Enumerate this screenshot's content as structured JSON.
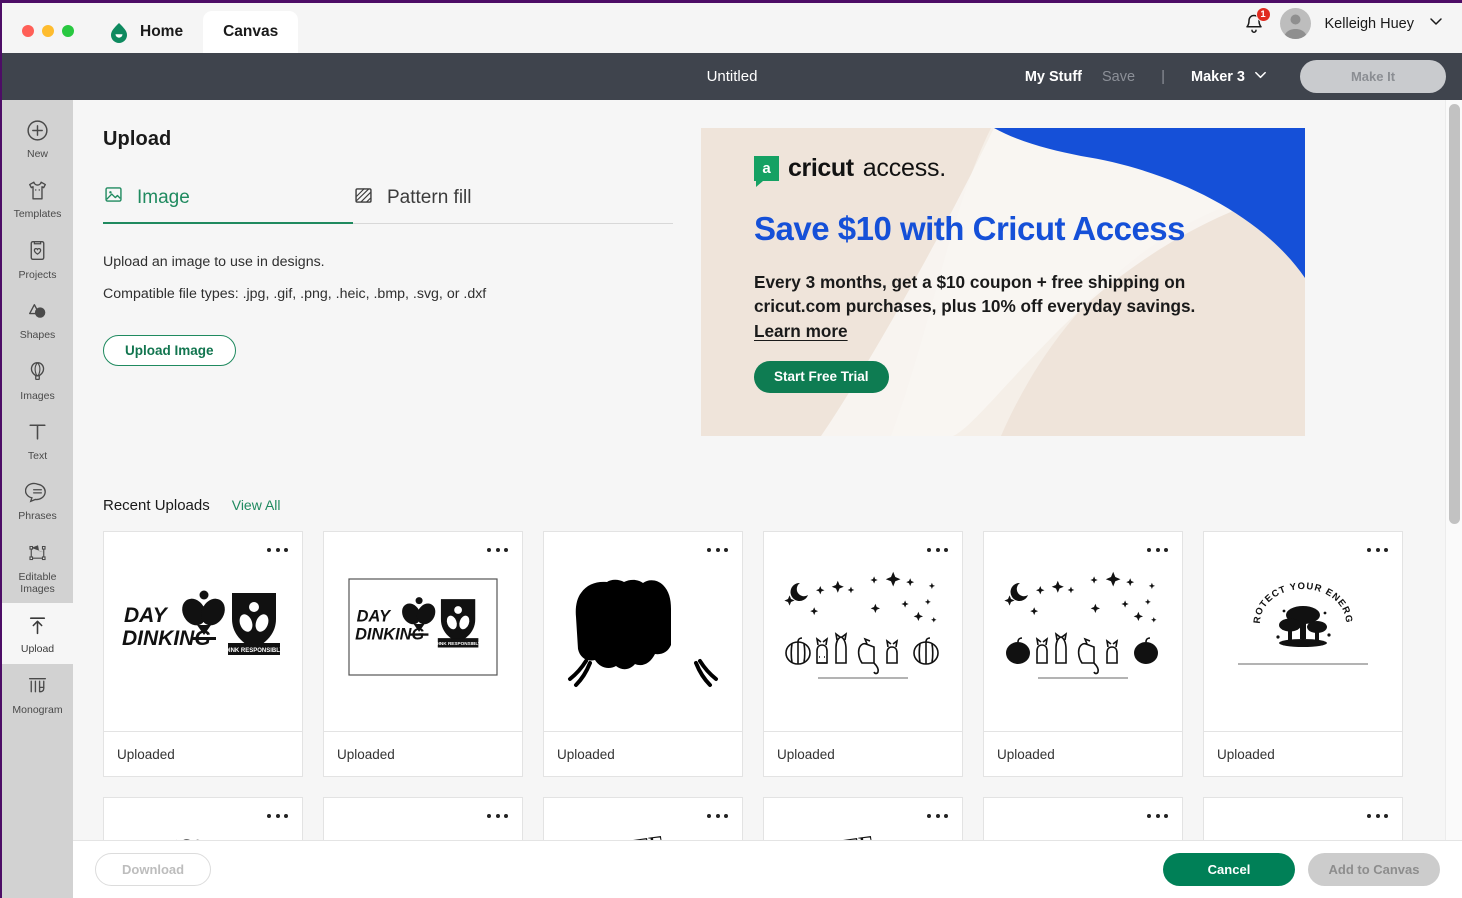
{
  "window": {
    "traffic_lights": [
      "close",
      "minimize",
      "maximize"
    ],
    "tabs": [
      {
        "label": "Home",
        "icon": "cricut-home-icon",
        "active": false
      },
      {
        "label": "Canvas",
        "icon": "",
        "active": true
      }
    ],
    "notifications": {
      "icon": "bell-icon",
      "count": "1"
    },
    "user": {
      "name": "Kelleigh Huey",
      "avatar": "user-avatar",
      "chevron": "chevron-down-icon"
    }
  },
  "toolbar": {
    "document_title": "Untitled",
    "my_stuff": "My Stuff",
    "save": "Save",
    "separator": "|",
    "machine": "Maker 3",
    "machine_chevron": "chevron-down-icon",
    "make_it": "Make It"
  },
  "sidebar": {
    "items": [
      {
        "label": "New",
        "icon": "plus-circle-icon",
        "active": false
      },
      {
        "label": "Templates",
        "icon": "tshirt-icon",
        "active": false
      },
      {
        "label": "Projects",
        "icon": "card-heart-icon",
        "active": false
      },
      {
        "label": "Shapes",
        "icon": "shapes-icon",
        "active": false
      },
      {
        "label": "Images",
        "icon": "hot-air-balloon-icon",
        "active": false
      },
      {
        "label": "Text",
        "icon": "text-t-icon",
        "active": false
      },
      {
        "label": "Phrases",
        "icon": "speech-bubble-icon",
        "active": false
      },
      {
        "label": "Editable Images",
        "icon": "editable-images-icon",
        "active": false
      },
      {
        "label": "Upload",
        "icon": "upload-arrow-icon",
        "active": true
      },
      {
        "label": "Monogram",
        "icon": "monogram-icon",
        "active": false
      }
    ]
  },
  "upload_panel": {
    "title": "Upload",
    "tabs": [
      {
        "label": "Image",
        "icon": "image-icon",
        "active": true
      },
      {
        "label": "Pattern fill",
        "icon": "pattern-fill-icon",
        "active": false
      }
    ],
    "description": "Upload an image to use in designs.",
    "file_types": "Compatible file types: .jpg, .gif, .png, .heic, .bmp, .svg, or .dxf",
    "upload_button": "Upload Image"
  },
  "banner": {
    "logo_badge": "a",
    "logo_cricut": "cricut",
    "logo_access": "access.",
    "headline": "Save $10 with Cricut Access",
    "paragraph": "Every 3 months, get a $10 coupon + free shipping on cricut.com purchases, plus 10% off everyday savings.",
    "link": "Learn more",
    "cta": "Start Free Trial",
    "colors": {
      "background": "#efe4da",
      "accent_blue": "#1550d8",
      "cta_green": "#0e7c52",
      "logo_green": "#15a163"
    }
  },
  "recent_uploads": {
    "title": "Recent Uploads",
    "view_all": "View All",
    "cards": [
      {
        "status": "Uploaded",
        "art": "day-dinking-pickleball-logo",
        "kebab": "more-options-icon"
      },
      {
        "status": "Uploaded",
        "art": "day-dinking-pickleball-logo-framed",
        "kebab": "more-options-icon"
      },
      {
        "status": "Uploaded",
        "art": "black-silhouette-blob",
        "kebab": "more-options-icon"
      },
      {
        "status": "Uploaded",
        "art": "halloween-cats-pumpkins-outline",
        "kebab": "more-options-icon"
      },
      {
        "status": "Uploaded",
        "art": "halloween-cats-pumpkins-filled",
        "kebab": "more-options-icon"
      },
      {
        "status": "Uploaded",
        "art": "protect-your-energy-mushrooms",
        "kebab": "more-options-icon"
      }
    ],
    "second_row": [
      {
        "art": "protect-your-energy-mushrooms-large",
        "kebab": "more-options-icon"
      },
      {
        "art": "blank-thumbnail",
        "kebab": "more-options-icon"
      },
      {
        "art": "protect-text-crop",
        "kebab": "more-options-icon"
      },
      {
        "art": "protect-text-crop-2",
        "kebab": "more-options-icon"
      },
      {
        "art": "black-bar-text",
        "kebab": "more-options-icon"
      },
      {
        "art": "framed-logo-crop",
        "kebab": "more-options-icon"
      }
    ]
  },
  "footer": {
    "download": "Download",
    "cancel": "Cancel",
    "add_to_canvas": "Add to Canvas"
  },
  "colors": {
    "toolbar_dark": "#3f444d",
    "brand_green": "#008057",
    "sidebar_grey": "#d2d2d2",
    "panel_bg": "#f6f6f6"
  }
}
